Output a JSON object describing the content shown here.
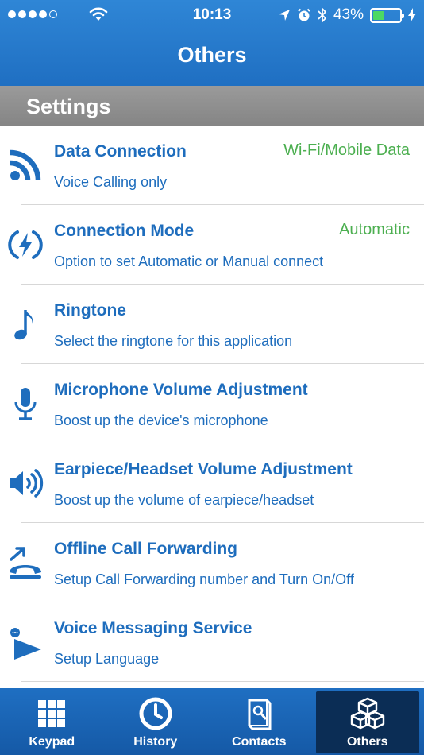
{
  "status_bar": {
    "time": "10:13",
    "battery_percent": "43%",
    "battery_level": 0.43,
    "signal_filled": 4,
    "signal_total": 5,
    "icons": [
      "wifi-icon",
      "location-arrow-icon",
      "alarm-icon",
      "bluetooth-icon",
      "charging-bolt-icon"
    ]
  },
  "header": {
    "title": "Others"
  },
  "section": {
    "title": "Settings"
  },
  "settings": [
    {
      "label": "Data Connection",
      "description": "Voice Calling only",
      "value": "Wi-Fi/Mobile Data",
      "icon": "wifi-signal-icon"
    },
    {
      "label": "Connection Mode",
      "description": "Option to set Automatic or Manual connect",
      "value": "Automatic",
      "icon": "connection-bolt-icon"
    },
    {
      "label": "Ringtone",
      "description": "Select the ringtone for this application",
      "value": "",
      "icon": "music-note-icon"
    },
    {
      "label": "Microphone Volume Adjustment",
      "description": "Boost up the device's microphone",
      "value": "",
      "icon": "microphone-icon"
    },
    {
      "label": "Earpiece/Headset Volume Adjustment",
      "description": "Boost up the volume of earpiece/headset",
      "value": "",
      "icon": "speaker-volume-icon"
    },
    {
      "label": "Offline Call Forwarding",
      "description": "Setup Call Forwarding number and Turn On/Off",
      "value": "",
      "icon": "call-forward-icon"
    },
    {
      "label": "Voice Messaging Service",
      "description": "Setup Language",
      "value": "",
      "icon": "voice-message-icon"
    }
  ],
  "tabs": [
    {
      "label": "Keypad",
      "icon": "keypad-icon",
      "active": false
    },
    {
      "label": "History",
      "icon": "clock-icon",
      "active": false
    },
    {
      "label": "Contacts",
      "icon": "contacts-book-icon",
      "active": false
    },
    {
      "label": "Others",
      "icon": "cubes-icon",
      "active": true
    }
  ],
  "colors": {
    "header_blue": "#1f6fc2",
    "text_blue": "#1e6dbd",
    "value_green": "#4caf50",
    "section_gray": "#8f8f8f",
    "active_tab": "#0b2d55",
    "battery_green": "#4cd964"
  }
}
